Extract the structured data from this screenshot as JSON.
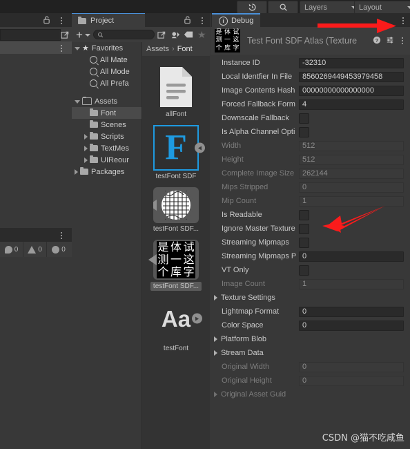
{
  "toolbar": {
    "history_icon": "history-icon",
    "search_icon": "search-icon",
    "layers_label": "Layers",
    "layout_label": "Layout"
  },
  "left_panel": {
    "lock_icon": "lock-icon",
    "kebab_icon": "kebab-menu-icon",
    "expand_icon": "expand-icon"
  },
  "console": {
    "kebab_icon": "kebab-menu-icon",
    "stats": [
      {
        "icon": "error-log-icon",
        "count": "0"
      },
      {
        "icon": "warning-icon",
        "count": "0"
      },
      {
        "icon": "info-icon",
        "count": "0"
      }
    ]
  },
  "project": {
    "tab_label": "Project",
    "folder_icon": "folder-icon",
    "lock_icon": "lock-icon",
    "kebab_icon": "kebab-menu-icon",
    "add_label": "+",
    "search_placeholder": "",
    "search_value": "",
    "search_icon": "search-icon",
    "expand_icon": "expand-icon",
    "filter_icons": [
      "avatar-filter-icon",
      "label-filter-icon",
      "favorite-star-icon"
    ],
    "tree": [
      {
        "label": "Favorites",
        "indent": 0,
        "arrow": "open",
        "icon": "star",
        "selected": false
      },
      {
        "label": "All Mate",
        "indent": 1,
        "arrow": "none",
        "icon": "search",
        "selected": false
      },
      {
        "label": "All Mode",
        "indent": 1,
        "arrow": "none",
        "icon": "search",
        "selected": false
      },
      {
        "label": "All Prefa",
        "indent": 1,
        "arrow": "none",
        "icon": "search",
        "selected": false
      },
      {
        "label": "",
        "indent": 0,
        "arrow": "none",
        "icon": "none",
        "selected": false
      },
      {
        "label": "Assets",
        "indent": 0,
        "arrow": "open",
        "icon": "folder-outline",
        "selected": false
      },
      {
        "label": "Font",
        "indent": 1,
        "arrow": "none",
        "icon": "folder",
        "selected": true
      },
      {
        "label": "Scenes",
        "indent": 1,
        "arrow": "none",
        "icon": "folder",
        "selected": false
      },
      {
        "label": "Scripts",
        "indent": 1,
        "arrow": "closed",
        "icon": "folder",
        "selected": false
      },
      {
        "label": "TextMes",
        "indent": 1,
        "arrow": "closed",
        "icon": "folder",
        "selected": false
      },
      {
        "label": "UIReour",
        "indent": 1,
        "arrow": "closed",
        "icon": "folder",
        "selected": false
      },
      {
        "label": "Packages",
        "indent": 0,
        "arrow": "closed",
        "icon": "folder",
        "selected": false
      }
    ],
    "breadcrumb": {
      "root": "Assets",
      "separator": "›",
      "current": "Font"
    },
    "assets": [
      {
        "name": "allFont",
        "thumb": "text-document-icon",
        "selected": false,
        "has_pip": false
      },
      {
        "name": "testFont SDF",
        "thumb": "font-asset-f-icon",
        "selected": false,
        "has_pip": true
      },
      {
        "name": "testFont SDF...",
        "thumb": "sdf-atlas-latin-icon",
        "selected": false,
        "has_pip": true
      },
      {
        "name": "testFont SDF...",
        "thumb": "sdf-atlas-cjk-icon",
        "selected": true,
        "has_pip": true
      },
      {
        "name": "testFont",
        "thumb": "font-aa-icon",
        "selected": false,
        "has_pip": true
      }
    ],
    "cjk_preview_chars": [
      "是",
      "体",
      "试",
      "测",
      "一",
      "这",
      "个",
      "库",
      "字"
    ],
    "aa_label": "Aa"
  },
  "inspector": {
    "tab_label": "Debug",
    "tab_icon": "info-icon",
    "kebab_icon": "kebab-menu-icon",
    "title": "Test Font SDF Atlas (Texture",
    "help_icon": "help-icon",
    "preset_icon": "preset-icon",
    "header_kebab_icon": "kebab-menu-icon",
    "properties": [
      {
        "label": "Instance ID",
        "type": "text",
        "value": "-32310",
        "dim": false
      },
      {
        "label": "Local Identfier In File",
        "type": "text",
        "value": "8560269449453979458",
        "dim": false
      },
      {
        "label": "Image Contents Hash",
        "type": "text",
        "value": "00000000000000000",
        "dim": false
      },
      {
        "label": "Forced Fallback Form",
        "type": "text",
        "value": "4",
        "dim": false
      },
      {
        "label": "Downscale Fallback",
        "type": "check",
        "value": "",
        "dim": false
      },
      {
        "label": "Is Alpha Channel Opti",
        "type": "check",
        "value": "",
        "dim": false
      },
      {
        "label": "Width",
        "type": "text",
        "value": "512",
        "dim": true
      },
      {
        "label": "Height",
        "type": "text",
        "value": "512",
        "dim": true
      },
      {
        "label": "Complete Image Size",
        "type": "text",
        "value": "262144",
        "dim": true
      },
      {
        "label": "Mips Stripped",
        "type": "text",
        "value": "0",
        "dim": true
      },
      {
        "label": "Mip Count",
        "type": "text",
        "value": "1",
        "dim": true
      },
      {
        "label": "Is Readable",
        "type": "check",
        "value": "",
        "dim": false
      },
      {
        "label": "Ignore Master Texture",
        "type": "check",
        "value": "",
        "dim": false
      },
      {
        "label": "Streaming Mipmaps",
        "type": "check",
        "value": "",
        "dim": false
      },
      {
        "label": "Streaming Mipmaps P",
        "type": "text",
        "value": "0",
        "dim": false
      },
      {
        "label": "VT Only",
        "type": "check",
        "value": "",
        "dim": false
      },
      {
        "label": "Image Count",
        "type": "text",
        "value": "1",
        "dim": true
      },
      {
        "label": "Texture Settings",
        "type": "foldout",
        "value": "",
        "dim": false
      },
      {
        "label": "Lightmap Format",
        "type": "text",
        "value": "0",
        "dim": false
      },
      {
        "label": "Color Space",
        "type": "text",
        "value": "0",
        "dim": false
      },
      {
        "label": "Platform Blob",
        "type": "foldout",
        "value": "",
        "dim": false
      },
      {
        "label": "Stream Data",
        "type": "foldout",
        "value": "",
        "dim": false
      },
      {
        "label": "Original Width",
        "type": "text",
        "value": "0",
        "dim": true
      },
      {
        "label": "Original Height",
        "type": "text",
        "value": "0",
        "dim": true
      },
      {
        "label": "Original Asset Guid",
        "type": "foldout",
        "value": "",
        "dim": true
      }
    ]
  },
  "annotations": {
    "arrow_color": "#fb1b1b",
    "arrows": [
      "arrow-to-inspector-kebab",
      "arrow-to-is-readable-checkbox"
    ]
  },
  "watermark": "CSDN @猫不吃咸鱼",
  "colors": {
    "background": "#383838",
    "panel_header": "#3c3c3c",
    "tabbar": "#2b2b2b",
    "field": "#2a2a2a",
    "accent": "#4a90d9",
    "selection": "#4a4a4a",
    "annotation": "#fb1b1b"
  }
}
